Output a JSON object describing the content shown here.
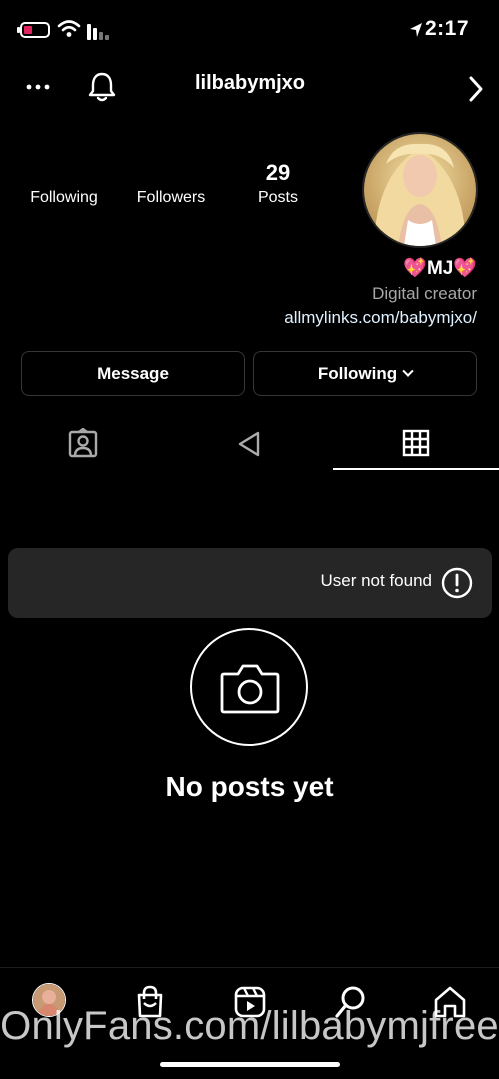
{
  "status_bar": {
    "time": "2:17",
    "battery_color": "#e0245e"
  },
  "header": {
    "username": "lilbabymjxo",
    "icons": [
      "more-icon",
      "bell-icon",
      "chevron-right-icon"
    ]
  },
  "profile": {
    "stats": {
      "posts_value": "29",
      "posts_label": "Posts",
      "followers_value": "",
      "followers_label": "Followers",
      "following_value": "",
      "following_label": "Following"
    },
    "bio": {
      "name": "💖MJ💖",
      "category": "Digital creator",
      "link": "allmylinks.com/babymjxo/"
    }
  },
  "actions": {
    "following_label": "Following",
    "message_label": "Message"
  },
  "tabs": [
    "grid-icon",
    "reels-icon",
    "tagged-icon"
  ],
  "toast": {
    "text": "User not found",
    "icon": "alert-icon"
  },
  "empty_state": {
    "title": "No posts yet",
    "icon": "camera-icon"
  },
  "bottom_nav": {
    "items": [
      "home-icon",
      "search-icon",
      "reels-icon",
      "shop-icon",
      "profile-avatar"
    ],
    "watermark": "OnlyFans.com/lilbabymjfree"
  },
  "colors": {
    "background": "#000000",
    "button_border": "#363636",
    "toast_bg": "#262626",
    "secondary_text": "#a8a8a8"
  }
}
